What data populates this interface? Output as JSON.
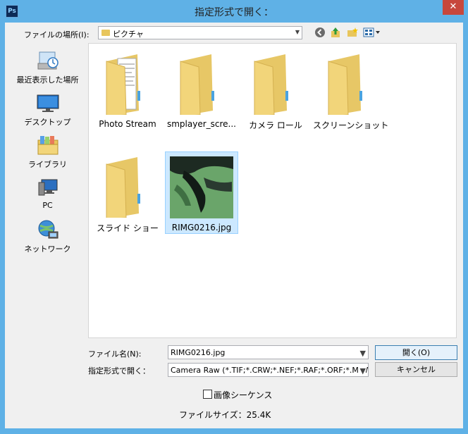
{
  "window": {
    "title": "指定形式で開く：",
    "app_badge": "Ps",
    "close_glyph": "✕"
  },
  "toolbar": {
    "lookin_label": "ファイルの場所(I):",
    "lookin_value": "ピクチャ"
  },
  "places": [
    {
      "label": "最近表示した場所",
      "icon": "recent-places-icon"
    },
    {
      "label": "デスクトップ",
      "icon": "desktop-icon"
    },
    {
      "label": "ライブラリ",
      "icon": "library-icon"
    },
    {
      "label": "PC",
      "icon": "pc-icon"
    },
    {
      "label": "ネットワーク",
      "icon": "network-icon"
    }
  ],
  "items": [
    {
      "label": "Photo Stream",
      "type": "folder"
    },
    {
      "label": "smplayer_scre...",
      "type": "folder"
    },
    {
      "label": "カメラ ロール",
      "type": "folder"
    },
    {
      "label": "スクリーンショット",
      "type": "folder"
    },
    {
      "label": "スライド ショー",
      "type": "folder"
    },
    {
      "label": "RIMG0216.jpg",
      "type": "image",
      "selected": true
    }
  ],
  "form": {
    "filename_label": "ファイル名(N):",
    "filename_value": "RIMG0216.jpg",
    "format_label": "指定形式で開く：",
    "format_value": "Camera Raw (*.TIF;*.CRW;*.NEF;*.RAF;*.ORF;*.MRW"
  },
  "buttons": {
    "open": "開く(O)",
    "cancel": "キャンセル"
  },
  "image_sequence": {
    "label": "画像シーケンス",
    "checked": false
  },
  "file_size": "ファイルサイズ：25.4K",
  "colors": {
    "title_bar": "#5fb1e6",
    "close": "#c7473c",
    "selection": "#cce8ff",
    "folder": "#f2d57a"
  }
}
